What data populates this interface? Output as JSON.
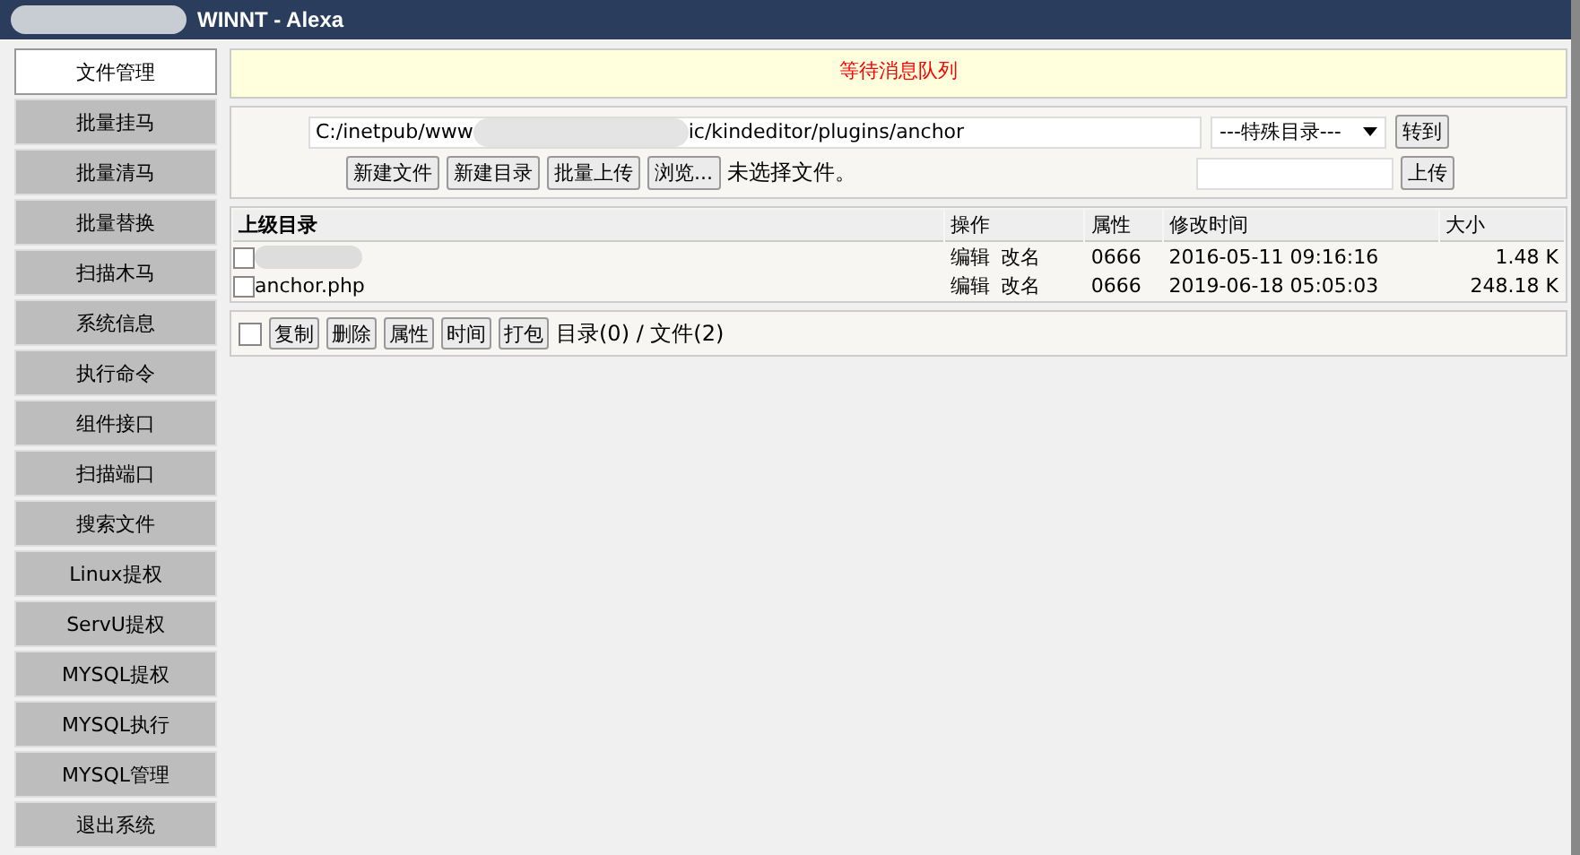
{
  "window": {
    "title": "WINNT - Alexa"
  },
  "sidebar": {
    "items": [
      {
        "label": "文件管理",
        "selected": true
      },
      {
        "label": "批量挂马",
        "selected": false
      },
      {
        "label": "批量清马",
        "selected": false
      },
      {
        "label": "批量替换",
        "selected": false
      },
      {
        "label": "扫描木马",
        "selected": false
      },
      {
        "label": "系统信息",
        "selected": false
      },
      {
        "label": "执行命令",
        "selected": false
      },
      {
        "label": "组件接口",
        "selected": false
      },
      {
        "label": "扫描端口",
        "selected": false
      },
      {
        "label": "搜索文件",
        "selected": false
      },
      {
        "label": "Linux提权",
        "selected": false
      },
      {
        "label": "ServU提权",
        "selected": false
      },
      {
        "label": "MYSQL提权",
        "selected": false
      },
      {
        "label": "MYSQL执行",
        "selected": false
      },
      {
        "label": "MYSQL管理",
        "selected": false
      },
      {
        "label": "退出系统",
        "selected": false
      }
    ]
  },
  "notice": "等待消息队列",
  "path_field": {
    "value_start": "C:/inetpub/www",
    "value_end": "ic/kindeditor/plugins/anchor"
  },
  "special_dir_select": "---特殊目录---",
  "goto_button": "转到",
  "action_buttons": [
    "新建文件",
    "新建目录",
    "批量上传"
  ],
  "browse_button": "浏览...",
  "file_status": "未选择文件。",
  "upload_button": "上传",
  "table": {
    "columns": [
      "上级目录",
      "操作",
      "属性",
      "修改时间",
      "大小"
    ],
    "rows": [
      {
        "name": "",
        "checked": false,
        "actions": [
          "编辑",
          "改名"
        ],
        "attr": "0666",
        "modified": "2016-05-11 09:16:16",
        "size": "1.48 K"
      },
      {
        "name": "anchor.php",
        "checked": false,
        "actions": [
          "编辑",
          "改名"
        ],
        "attr": "0666",
        "modified": "2019-06-18 05:05:03",
        "size": "248.18 K"
      }
    ]
  },
  "bottom_bar": {
    "select_all_checked": false,
    "buttons": [
      "复制",
      "删除",
      "属性",
      "时间",
      "打包"
    ],
    "summary": "目录(0) / 文件(2)"
  }
}
